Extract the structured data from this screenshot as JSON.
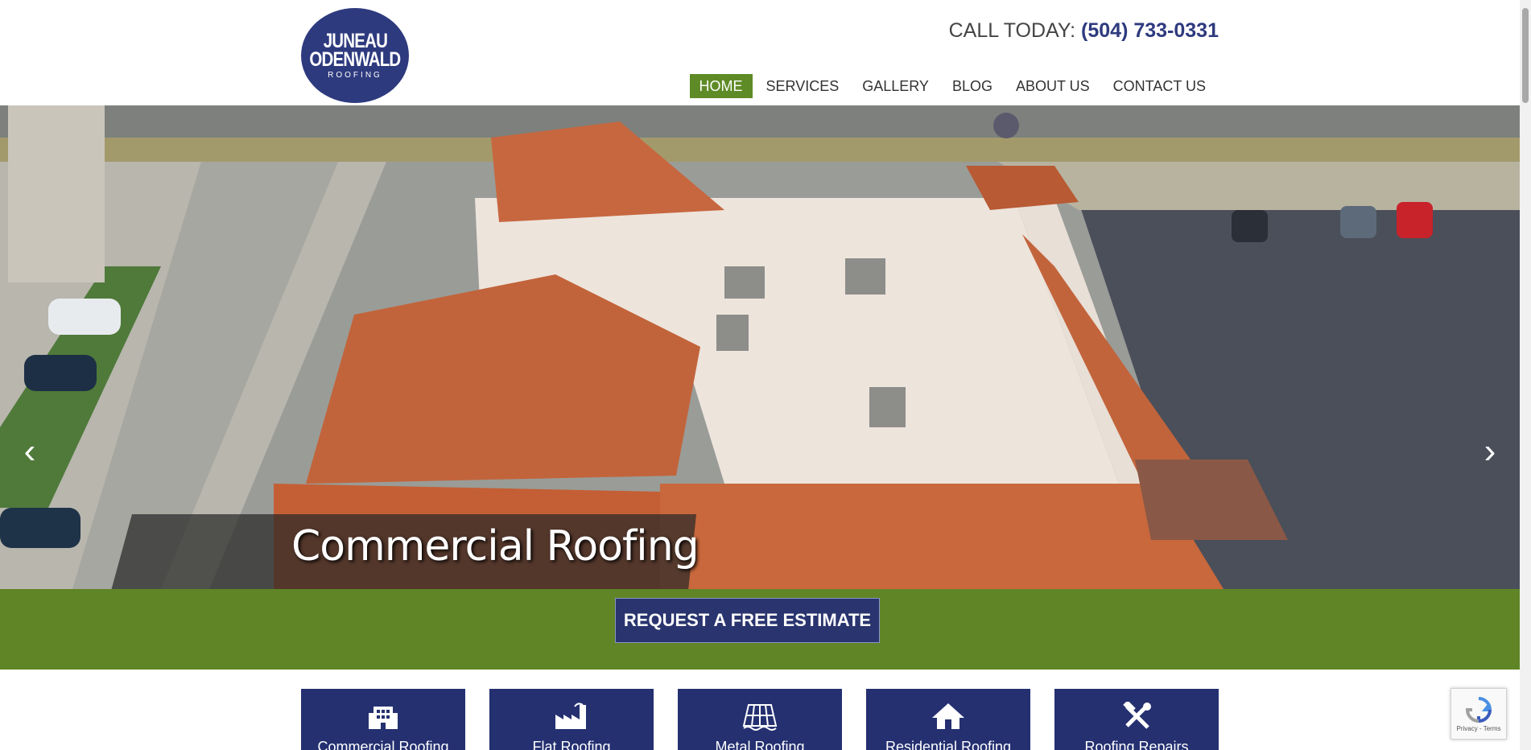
{
  "header": {
    "logo": {
      "line1": "JUNEAU",
      "line2": "ODENWALD",
      "line3": "ROOFING"
    },
    "call_label": "CALL TODAY:",
    "phone": "(504) 733-0331",
    "nav": [
      {
        "label": "HOME",
        "active": true
      },
      {
        "label": "SERVICES"
      },
      {
        "label": "GALLERY"
      },
      {
        "label": "BLOG"
      },
      {
        "label": "ABOUT US"
      },
      {
        "label": "CONTACT US"
      }
    ]
  },
  "hero": {
    "caption": "Commercial Roofing",
    "prev_icon": "chevron-left-icon",
    "next_icon": "chevron-right-icon"
  },
  "cta": {
    "label": "REQUEST A FREE ESTIMATE"
  },
  "tiles": [
    {
      "label": "Commercial Roofing",
      "icon": "building-icon"
    },
    {
      "label": "Flat Roofing",
      "icon": "factory-icon"
    },
    {
      "label": "Metal Roofing",
      "icon": "metal-roof-icon"
    },
    {
      "label": "Residential Roofing",
      "icon": "house-icon"
    },
    {
      "label": "Roofing Repairs",
      "icon": "tools-icon"
    }
  ],
  "recaptcha": {
    "text": "Privacy - Terms"
  },
  "colors": {
    "brand_blue": "#2e3a7e",
    "brand_green": "#5f8526",
    "tile_blue": "#243070"
  }
}
